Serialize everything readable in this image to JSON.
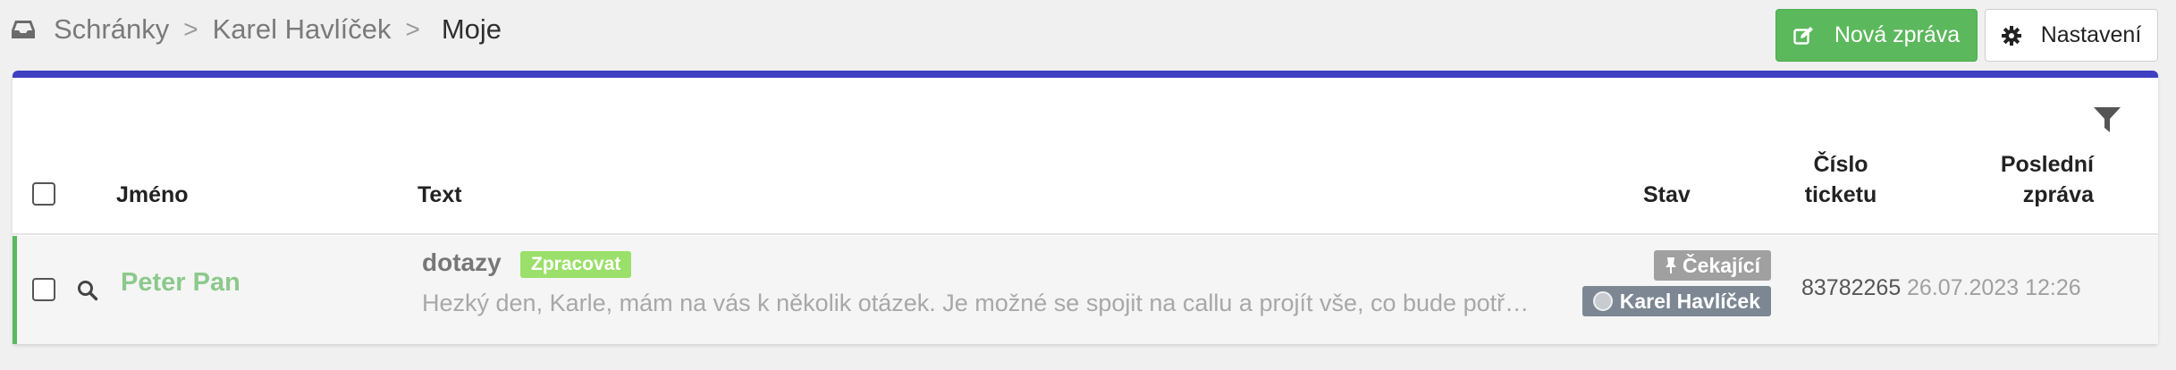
{
  "breadcrumb": {
    "items": [
      "Schránky",
      "Karel Havlíček",
      "Moje"
    ],
    "separator": ">"
  },
  "toolbar": {
    "new_message_label": "Nová zpráva",
    "settings_label": "Nastavení"
  },
  "table": {
    "columns": {
      "name": "Jméno",
      "text": "Text",
      "status": "Stav",
      "ticket_line1": "Číslo",
      "ticket_line2": "ticketu",
      "last_line1": "Poslední",
      "last_line2": "zpráva"
    },
    "rows": [
      {
        "name": "Peter Pan",
        "subject": "dotazy",
        "tag": "Zpracovat",
        "preview": "Hezký den, Karle, mám na vás k několik otázek. Je možné se spojit na callu a projít vše, co bude potřeba?",
        "status": "Čekající",
        "assignee": "Karel Havlíček",
        "ticket": "83782265",
        "last_message": "26.07.2023 12:26"
      }
    ]
  },
  "colors": {
    "accent_bar": "#3e3fc1",
    "primary_green": "#5cb85c",
    "tag_green": "#9be06a",
    "status_badge": "#a0a0a0",
    "assignee_badge": "#7c8793"
  },
  "icons": [
    "inbox-icon",
    "edit-icon",
    "gear-icon",
    "filter-icon",
    "search-icon",
    "pin-icon",
    "avatar"
  ]
}
